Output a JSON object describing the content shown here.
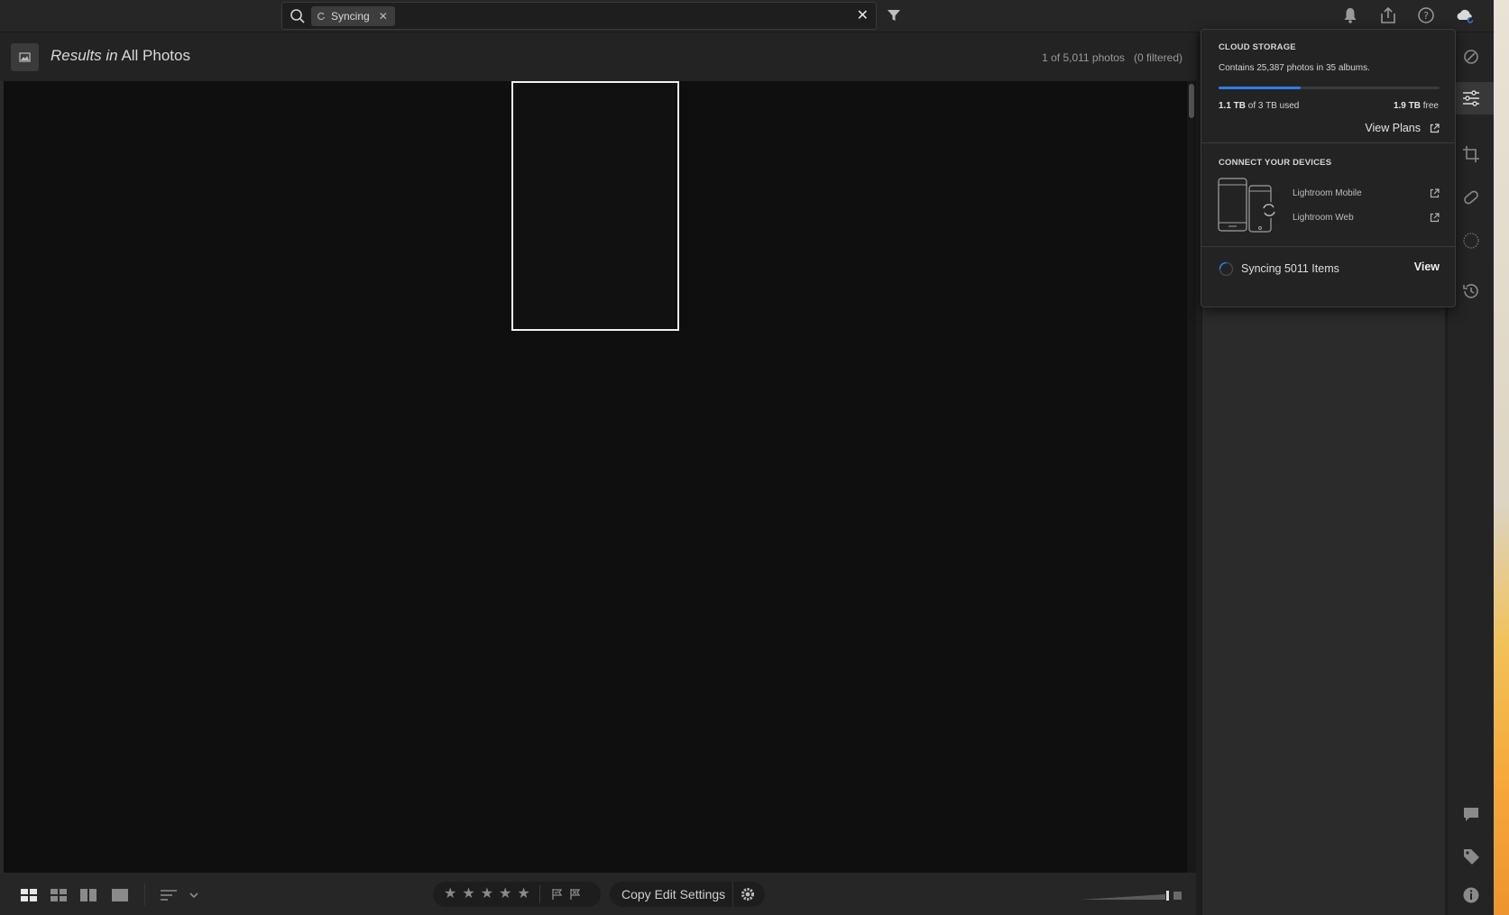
{
  "search": {
    "chip_label": "Syncing"
  },
  "results": {
    "prefix": "Results in",
    "scope": "All Photos",
    "count": "1 of 5,011 photos",
    "filtered": "(0 filtered)"
  },
  "bottombar": {
    "copy_edit_label": "Copy Edit Settings"
  },
  "cloud_popup": {
    "storage_title": "CLOUD STORAGE",
    "contains_text": "Contains 25,387 photos in 35 albums.",
    "used_amount": "1.1 TB",
    "used_suffix": "of 3 TB used",
    "free_amount": "1.9 TB",
    "free_suffix": "free",
    "storage_used_fraction": 0.37,
    "view_plans_label": "View Plans",
    "devices_title": "CONNECT YOUR DEVICES",
    "mobile_label": "Lightroom Mobile",
    "web_label": "Lightroom Web",
    "sync_status": "Syncing 5011 Items",
    "sync_view_label": "View"
  },
  "colors": {
    "accent": "#2e7ce3",
    "grid_background": "#0f0f0f",
    "panel": "#2b2b2b"
  },
  "icons": {
    "top": [
      "search-icon",
      "sync-icon",
      "close-icon",
      "filter-icon",
      "bell-icon",
      "share-icon",
      "help-icon",
      "cloud-sync-icon"
    ],
    "right_strip": [
      "presets-icon",
      "edit-sliders-icon",
      "crop-icon",
      "healing-icon",
      "masking-icon",
      "history-icon",
      "comment-icon",
      "tag-icon",
      "info-icon"
    ],
    "bottom": [
      "square-grid-view-icon",
      "grid-view-icon",
      "compare-view-icon",
      "detail-view-icon",
      "sort-icon",
      "chevron-down-icon",
      "star-icon",
      "flag-pick-icon",
      "flag-reject-icon",
      "gear-icon"
    ]
  }
}
